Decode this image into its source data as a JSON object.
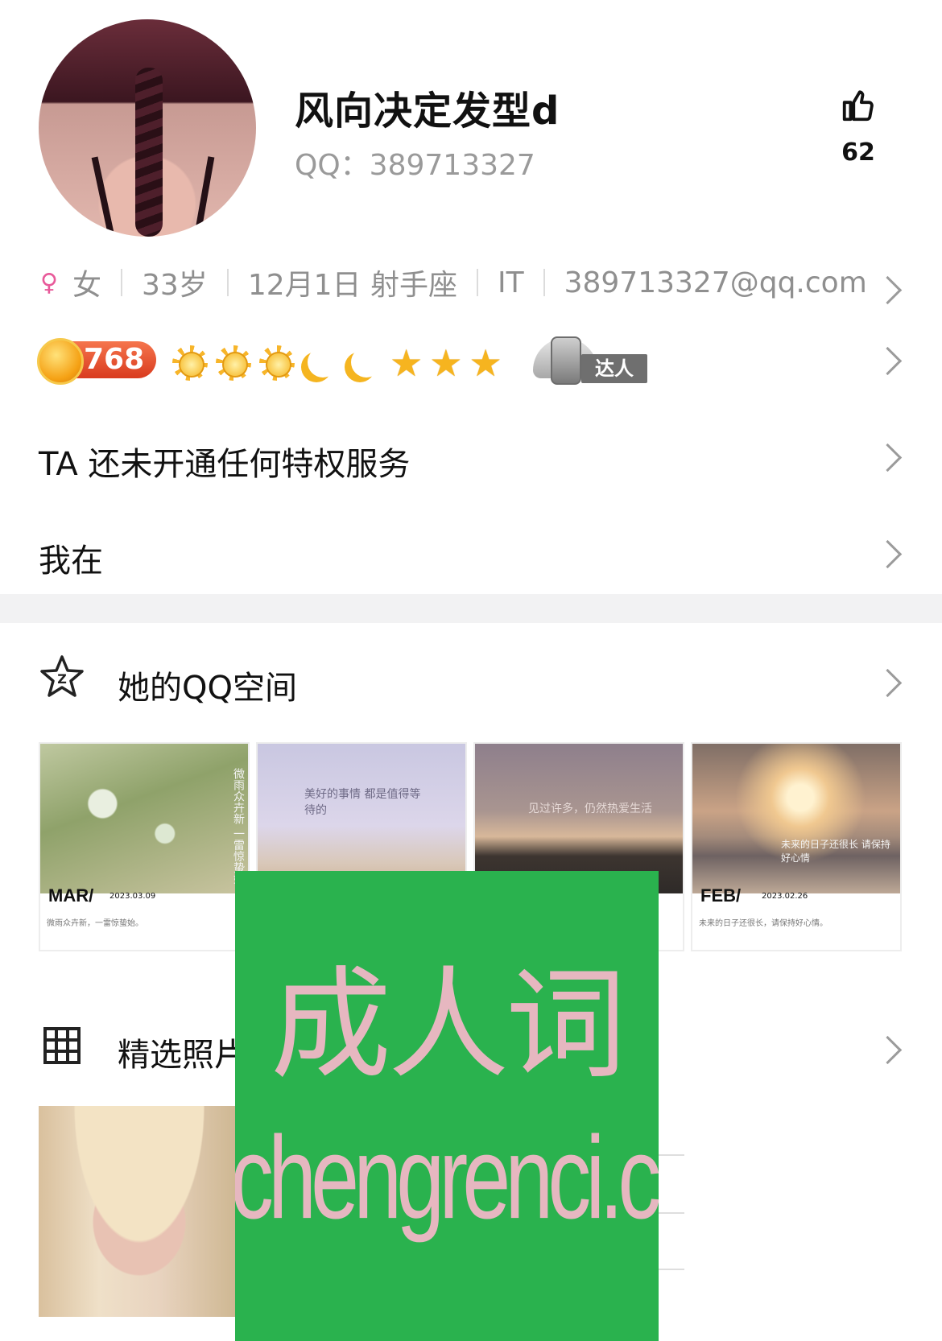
{
  "profile": {
    "nickname": "风向决定发型d",
    "qq_line": "QQ：389713327",
    "likes": "62"
  },
  "info": {
    "gender": "女",
    "age": "33岁",
    "birthday": "12月1日 射手座",
    "job": "IT",
    "email": "389713327@qq.com"
  },
  "level": {
    "value": "768",
    "icons": [
      "sun-icon",
      "sun-icon",
      "sun-icon",
      "moon-icon",
      "moon-icon",
      "star-icon",
      "star-icon",
      "star-icon"
    ],
    "daren_tag": "达人"
  },
  "rows": {
    "privilege": "TA 还未开通任何特权服务",
    "location": "我在"
  },
  "qzone": {
    "title": "她的QQ空间",
    "cards": [
      {
        "month": "MAR/",
        "date": "2023.03.09",
        "caption": "微雨众卉新，一雷惊蛰始。",
        "overlay": "微雨众卉新 一雷惊蛰始"
      },
      {
        "month": "",
        "date": "",
        "caption": "",
        "overlay": "美好的事情 都是值得等待的"
      },
      {
        "month": "",
        "date": "",
        "caption": "",
        "overlay": "见过许多，仍然热爱生活"
      },
      {
        "month": "FEB/",
        "date": "2023.02.26",
        "caption": "未来的日子还很长，请保持好心情。",
        "overlay": "未来的日子还很长 请保持好心情"
      }
    ]
  },
  "photos": {
    "title": "精选照片"
  },
  "watermark": {
    "cn": "成人词",
    "en": "chengrenci.com"
  },
  "colors": {
    "female": "#e85a9a",
    "level_badge": "#e2492a",
    "watermark_bg": "#2ab24e",
    "watermark_text": "#e6b7c0"
  }
}
